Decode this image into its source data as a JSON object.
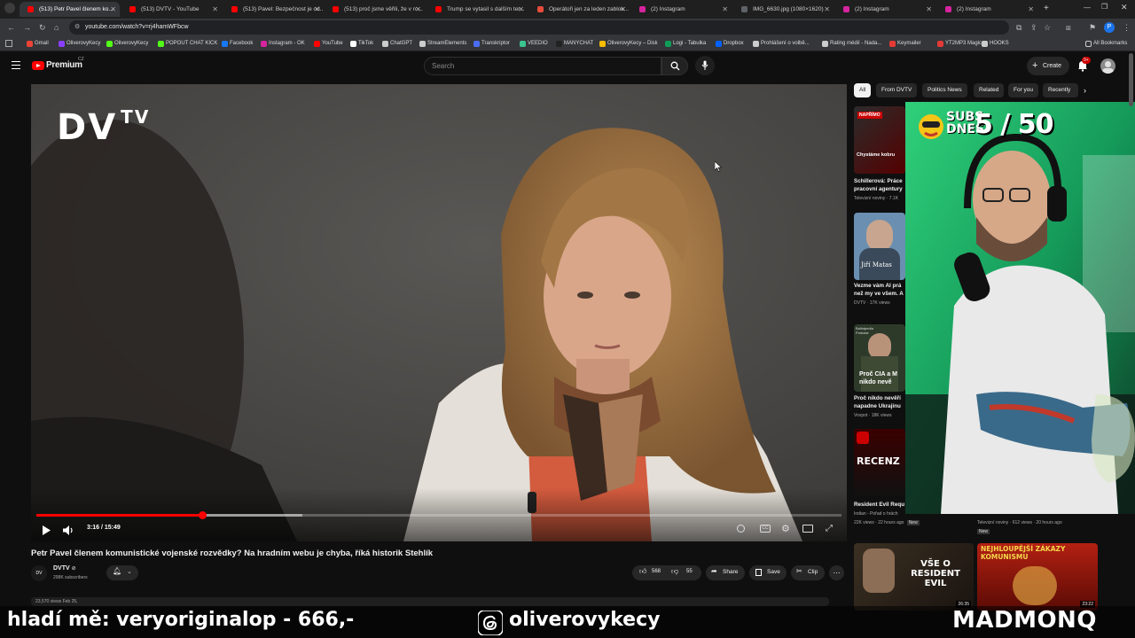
{
  "browser": {
    "tabs": [
      {
        "label": "(513) Petr Pavel členem ko...",
        "active": true,
        "color": "#ff0000"
      },
      {
        "label": "(513) DVTV - YouTube",
        "active": false,
        "color": "#ff0000"
      },
      {
        "label": "(513) Pavel: Bezpečnost je od...",
        "active": false,
        "color": "#ff0000"
      },
      {
        "label": "(513) proč jsme věřili, že v ro...",
        "active": false,
        "color": "#ff0000"
      },
      {
        "label": "Trump se vytasil s dalším ter...",
        "active": false,
        "color": "#ff0000"
      },
      {
        "label": "Operátoři jen za leden zablok...",
        "active": false,
        "color": "#e74c3c"
      },
      {
        "label": "(2) Instagram",
        "active": false,
        "color": "#d6249f"
      },
      {
        "label": "IMG_6630.jpg (1080×1620)",
        "active": false,
        "color": "#5f6368"
      },
      {
        "label": "(2) Instagram",
        "active": false,
        "color": "#d6249f"
      },
      {
        "label": "(2) Instagram",
        "active": false,
        "color": "#d6249f"
      }
    ],
    "url": "youtube.com/watch?v=rj4hamWFbcw",
    "bookmarks": [
      {
        "label": "Gmail",
        "color": "#ea4335"
      },
      {
        "label": "OliverovyKecy",
        "color": "#8a3ffc"
      },
      {
        "label": "OliverovyKecy",
        "color": "#53fc18"
      },
      {
        "label": "POPOUT CHAT KICK",
        "color": "#53fc18"
      },
      {
        "label": "Facebook",
        "color": "#1877f2"
      },
      {
        "label": "Instagram - OK",
        "color": "#d6249f"
      },
      {
        "label": "YouTube",
        "color": "#ff0000"
      },
      {
        "label": "TikTok",
        "color": "#ffffff"
      },
      {
        "label": "ChatGPT",
        "color": "#cccccc"
      },
      {
        "label": "StreamElements",
        "color": "#cccccc"
      },
      {
        "label": "Transkriptor",
        "color": "#4a6cf7"
      },
      {
        "label": "VEEDIO",
        "color": "#3cc48f"
      },
      {
        "label": "MANYCHAT",
        "color": "#222222"
      },
      {
        "label": "OliverovyKecy – Disk",
        "color": "#fbbc04"
      },
      {
        "label": "Logi - Tabulka",
        "color": "#0f9d58"
      },
      {
        "label": "Dropbox",
        "color": "#0061ff"
      },
      {
        "label": "Prohlášení o volbě...",
        "color": "#cccccc"
      },
      {
        "label": "Rating médií - Nada...",
        "color": "#cccccc"
      },
      {
        "label": "Keymailer",
        "color": "#e53935"
      },
      {
        "label": "YT2MP3 Magic",
        "color": "#e53935"
      },
      {
        "label": "HOOKS",
        "color": "#cccccc"
      }
    ],
    "all_bookmarks_label": "All Bookmarks"
  },
  "youtube": {
    "logo_text": "Premium",
    "logo_sup": "CZ",
    "search_placeholder": "Search",
    "create_label": "Create",
    "notif_count": "9+",
    "chips": [
      "All",
      "From DVTV",
      "Politics News",
      "Related",
      "For you",
      "Recently"
    ]
  },
  "video": {
    "watermark": "DV",
    "watermark_sup": "TV",
    "time": "3:16 / 15:49",
    "progress": 0.206,
    "buffered": 0.33,
    "title": "Petr Pavel členem komunistické vojenské rozvědky? Na hradním webu je chyba, říká historik Stehlík",
    "channel": "DVTV",
    "subscribers": "298K subscribers",
    "likes": "568",
    "dislikes": "55",
    "share_label": "Share",
    "save_label": "Save",
    "clip_label": "Clip",
    "views_partial": "23,570 views  Feb 25,"
  },
  "recommendations": [
    {
      "badge": "NAPŘÍMO",
      "thumb_text": "Chystáme kobru",
      "title": "Schillerová: Práce",
      "title2": "pracovní agentury",
      "meta": "Televizní noviny · 7.1K"
    },
    {
      "badge": "",
      "thumb_text": "Jiří Matas",
      "title": "Vezme vám AI prá",
      "title2": "než my ve všem. A",
      "meta": "DVTV · 17K views"
    },
    {
      "badge": "Ballotpedia Podcast",
      "thumb_text": "Proč CIA a M nikdo nevě",
      "title": "Proč nikdo nevěří",
      "title2": "napadne Ukrajinu",
      "meta": "Voxpot · 18K views"
    },
    {
      "badge": "",
      "thumb_text": "RECENZ",
      "title": "Resident Evil Requ",
      "title2": "",
      "meta": "Indian - Pořad o hrách · 22K views · 22 hours ago"
    }
  ],
  "bottom_recs": [
    {
      "title": "VŠE O RESIDENT EVIL",
      "duration": "26:35"
    },
    {
      "title": "NEJHLOUPĚJŠÍ ZÁKAZY KOMUNISMU",
      "duration": "23:22"
    }
  ],
  "bottom_rec_meta": [
    {
      "line1": "Indian - Pořad o hrách",
      "line2": "22K views · 22 hours ago",
      "badge": "New"
    },
    {
      "line1": "Televizní noviny",
      "line2": "612 views · 20 hours ago",
      "badge": "New"
    }
  ],
  "stream_overlay": {
    "subs_label_1": "SUBS",
    "subs_label_2": "DNES",
    "subs_count": "5 / 50",
    "donate_text": "hladí mě: veryoriginalop - 666,-",
    "threads_handle": "oliverovykecy",
    "brand": "MADMONQ"
  }
}
